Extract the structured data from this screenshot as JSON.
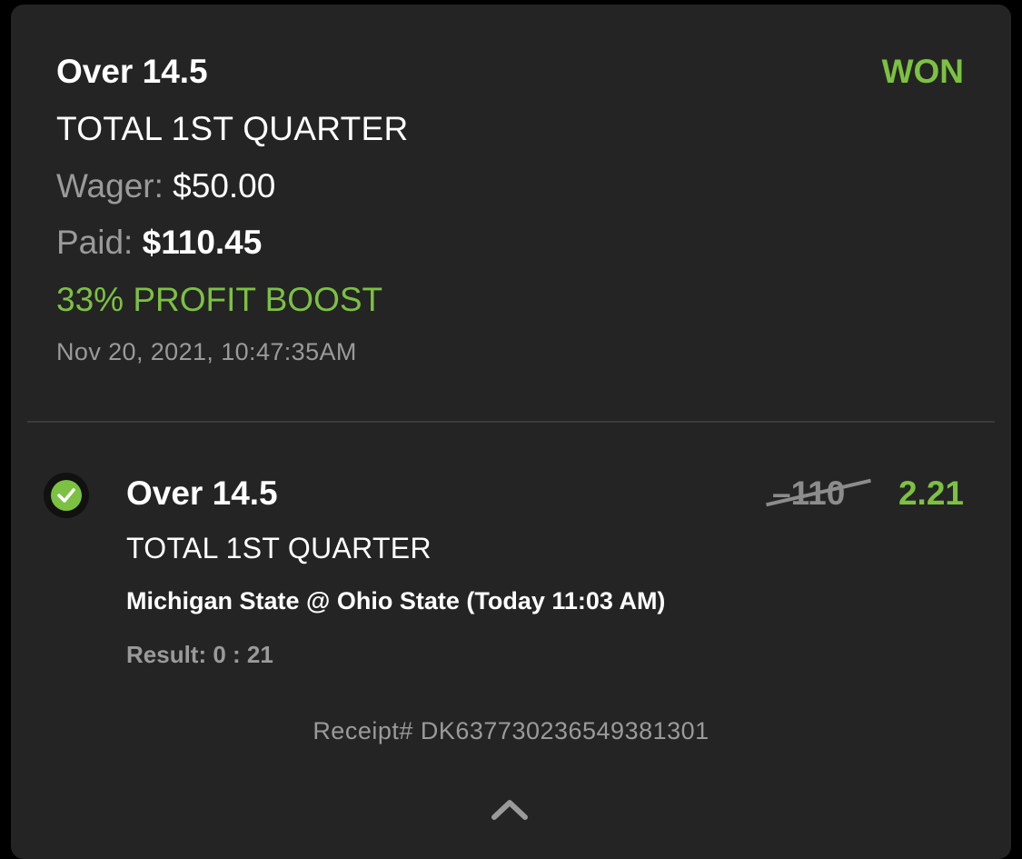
{
  "bet": {
    "selection": "Over 14.5",
    "status": "WON",
    "market": "TOTAL 1ST QUARTER",
    "wager_label": "Wager:",
    "wager_value": "$50.00",
    "paid_label": "Paid:",
    "paid_value": "$110.45",
    "promo": "33% PROFIT BOOST",
    "placed_at": "Nov 20, 2021, 10:47:35AM"
  },
  "leg": {
    "selection": "Over 14.5",
    "original_odds": "–110",
    "boosted_odds": "2.21",
    "market": "TOTAL 1ST QUARTER",
    "event": "Michigan State @ Ohio State (Today 11:03 AM)",
    "result": "Result: 0 : 21",
    "status_icon": "check-circle-icon"
  },
  "receipt": "Receipt# DK637730236549381301",
  "collapse_icon": "chevron-up-icon",
  "colors": {
    "accent_green": "#7cc142",
    "card_bg": "#242424",
    "muted_text": "#9a9a9a"
  }
}
